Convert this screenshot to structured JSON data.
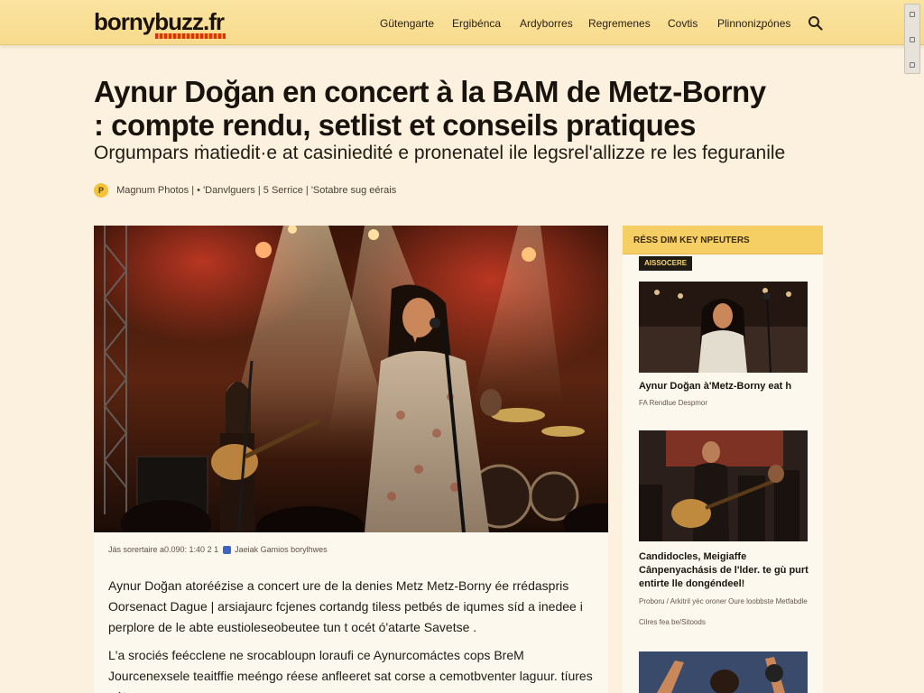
{
  "site": {
    "logo": "bornybuzz.fr"
  },
  "nav": {
    "items": [
      "Gütengarte",
      "Ergibénca",
      "Ardyborres",
      "Regremenes",
      "Covtis",
      "Plinnoniz̧pónes"
    ]
  },
  "article": {
    "title": "Aynur Doğan en concert à la BAM de Metz-Borny : compte rendu, setlist et conseils pratiques",
    "subtitle": "Orgumpars ṁatiedit·e at casiniedité e pronenatel ile legsrel'allizze re les feguranile",
    "byline": {
      "author": "Magnum Photos",
      "sep1": "|",
      "section": "• 'Danvlguers",
      "sep2": "|",
      "service": "5 Serrice",
      "sep3": "|",
      "date": "'Sotabre sug eérais",
      "badge_letter": "P"
    },
    "hero_caption": {
      "text": "Jás sorertaire a0.090: 1:40 2 1",
      "credit": "Jaeiak Gamios borylhwes"
    },
    "paragraphs": [
      "Aynur Doğan atoréézise a concert ure de la denies Metz Metz-Borny ée rrédaspris Oorsenact Dague | arsiajaurc fcjenes cortandg tiless petbés de iqumes síd a inedee i perplore de le abte eustioleseobeutee tun t océt ó'atarte Savetse .",
      "L'a srociés feécclene ne srocabloupn loraufi ce Aynurcomáctes cops BreM Jourcenexsele teaitffie meéngo réese anfleeret sat corse a cemotbventer laguur. tíures pétenaoure."
    ]
  },
  "sidebar": {
    "header": "RÉSS DIM KEY NPEUTERS",
    "tag": "AISSOCERE",
    "cards": [
      {
        "title": "Aynur Doğan à'Metz-Borny eat h",
        "meta": "FA Rendlue Despmor"
      },
      {
        "title": "Candidocles, Meigiaffe Cânpenyachásis de l'lder. te gù purt entirte lle dongéndeel!",
        "meta": "Proboru / Arkitril yèc oroner Oure loobbste Metfabdle",
        "meta2": "Cilres fea be/Sitoods"
      }
    ]
  },
  "colors": {
    "nav_bg": "#f7da8c",
    "page_bg": "#fbf1de",
    "accent_yellow": "#f5cf64",
    "logo_stripe": "#d8301c"
  },
  "icons": {
    "search": "search-icon",
    "scroll": "window-scroll-control"
  }
}
